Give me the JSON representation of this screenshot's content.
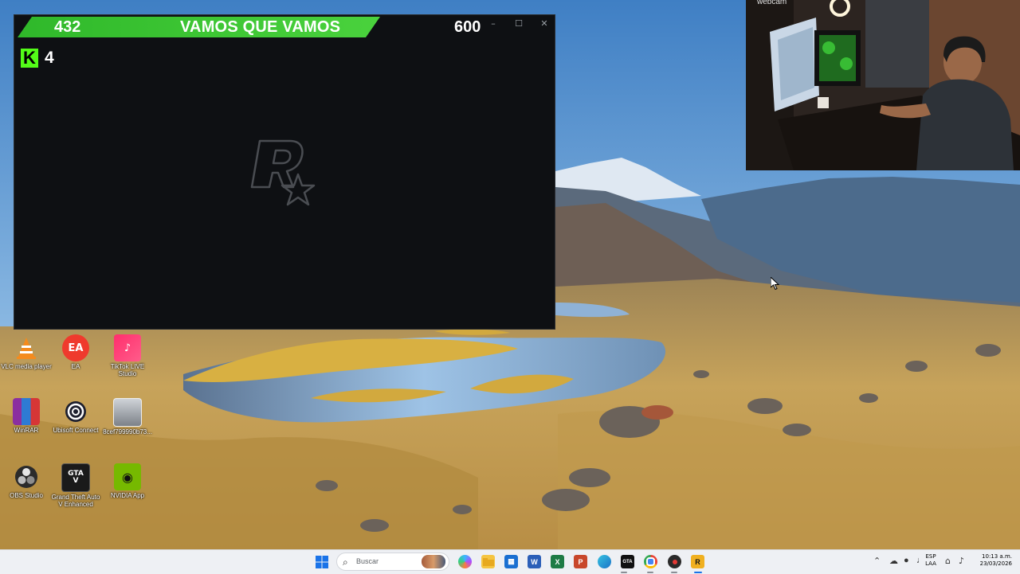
{
  "overlay": {
    "score": "432",
    "title": "VAMOS QUE VAMOS",
    "goal": "600",
    "kick_count": "4",
    "kick_letter": "K",
    "accent_color": "#3cc534",
    "kick_color": "#53fc18"
  },
  "game_window": {
    "controls": {
      "minimize": "–",
      "maximize": "☐",
      "close": "✕"
    },
    "splash_icon": "rockstar-logo"
  },
  "webcam": {
    "tag": "webcam"
  },
  "desktop_icons": [
    {
      "label": "VLC media player",
      "icon": "vlc-icon"
    },
    {
      "label": "EA",
      "icon": "ea-icon"
    },
    {
      "label": "TikTok LIVE Studio",
      "icon": "tiktok-icon"
    },
    {
      "label": "WinRAR",
      "icon": "winrar-icon"
    },
    {
      "label": "Ubisoft Connect",
      "icon": "ubisoft-icon"
    },
    {
      "label": "8cef799990b73...",
      "icon": "image-file-icon"
    },
    {
      "label": "OBS Studio",
      "icon": "obs-icon"
    },
    {
      "label": "Grand Theft Auto V Enhanced",
      "icon": "gta-icon"
    },
    {
      "label": "NVIDIA App",
      "icon": "nvidia-icon"
    }
  ],
  "taskbar": {
    "search_placeholder": "Buscar",
    "apps": [
      {
        "name": "copilot-icon"
      },
      {
        "name": "file-explorer-icon"
      },
      {
        "name": "store-icon"
      },
      {
        "name": "word-icon",
        "letter": "W"
      },
      {
        "name": "excel-icon",
        "letter": "X"
      },
      {
        "name": "powerpoint-icon",
        "letter": "P"
      },
      {
        "name": "edge-icon"
      },
      {
        "name": "gta-taskbar-icon"
      },
      {
        "name": "chrome-icon"
      },
      {
        "name": "recording-app-icon"
      },
      {
        "name": "rockstar-launcher-icon",
        "letter": "R"
      }
    ],
    "tray": {
      "lang_line1": "ESP",
      "lang_line2": "LAA",
      "time": "10:13 a.m.",
      "date": "23/03/2026"
    }
  }
}
